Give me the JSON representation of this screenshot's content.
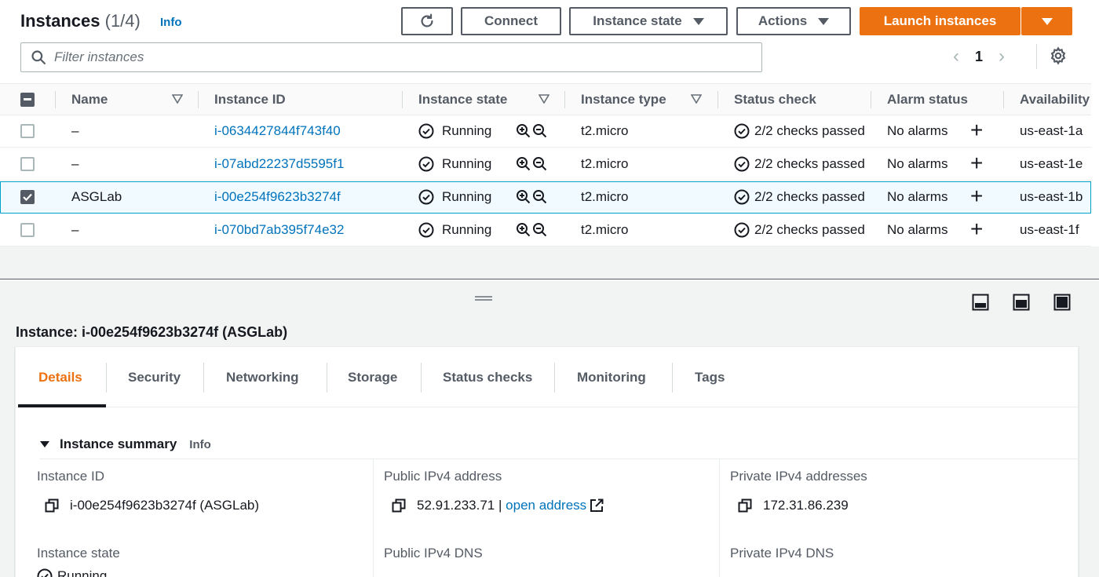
{
  "header": {
    "title": "Instances",
    "count": "(1/4)",
    "info": "Info",
    "connect": "Connect",
    "instance_state": "Instance state",
    "actions": "Actions",
    "launch": "Launch instances",
    "search_placeholder": "Filter instances",
    "page": "1"
  },
  "columns": [
    "Name",
    "Instance ID",
    "Instance state",
    "Instance type",
    "Status check",
    "Alarm status",
    "Availability"
  ],
  "rows": [
    {
      "name": "–",
      "id": "i-0634427844f743f40",
      "state": "Running",
      "type": "t2.micro",
      "status": "2/2 checks passed",
      "alarm": "No alarms",
      "az": "us-east-1a",
      "selected": false
    },
    {
      "name": "–",
      "id": "i-07abd22237d5595f1",
      "state": "Running",
      "type": "t2.micro",
      "status": "2/2 checks passed",
      "alarm": "No alarms",
      "az": "us-east-1e",
      "selected": false
    },
    {
      "name": "ASGLab",
      "id": "i-00e254f9623b3274f",
      "state": "Running",
      "type": "t2.micro",
      "status": "2/2 checks passed",
      "alarm": "No alarms",
      "az": "us-east-1b",
      "selected": true
    },
    {
      "name": "–",
      "id": "i-070bd7ab395f74e32",
      "state": "Running",
      "type": "t2.micro",
      "status": "2/2 checks passed",
      "alarm": "No alarms",
      "az": "us-east-1f",
      "selected": false
    }
  ],
  "detail": {
    "title": "Instance: i-00e254f9623b3274f (ASGLab)",
    "tabs": [
      "Details",
      "Security",
      "Networking",
      "Storage",
      "Status checks",
      "Monitoring",
      "Tags"
    ],
    "summary_title": "Instance summary",
    "summary_info": "Info",
    "instance_id_label": "Instance ID",
    "instance_id_value": "i-00e254f9623b3274f (ASGLab)",
    "public_ip_label": "Public IPv4 address",
    "public_ip_value": "52.91.233.71",
    "public_ip_sep": "|",
    "open_address": "open address",
    "private_ip_label": "Private IPv4 addresses",
    "private_ip_value": "172.31.86.239",
    "instance_state_label": "Instance state",
    "instance_state_value": "Running",
    "public_dns_label": "Public IPv4 DNS",
    "private_dns_label": "Private IPv4 DNS"
  },
  "colors": {
    "accent": "#ec7211",
    "link": "#0073bb",
    "text": "#16191f",
    "muted": "#545b64",
    "success": "#1d8102"
  },
  "icons": [
    "refresh-icon",
    "search-icon",
    "settings-gear-icon",
    "checkmark-circle-icon",
    "zoom-in-icon",
    "zoom-out-icon",
    "plus-icon",
    "copy-icon",
    "external-link-icon",
    "caret-down-icon"
  ]
}
